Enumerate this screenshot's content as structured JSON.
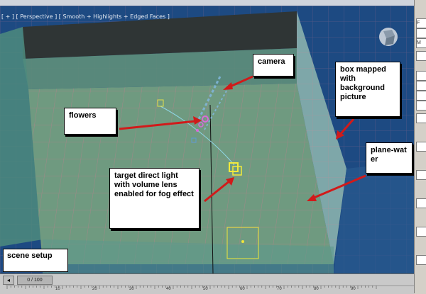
{
  "viewport": {
    "label": "[ + ] [ Perspective ] [ Smooth + Highlights + Edged Faces ]",
    "background": "#1a3f73",
    "grid_color": "#c87a8e",
    "floor_color": "#6f9a80"
  },
  "annotations": {
    "camera": "camera",
    "box": "box mapped with background picture",
    "flowers": "flowers",
    "plane_water": "plane-water",
    "light": "target direct light with volume lens enabled for fog effect",
    "scene": "scene setup"
  },
  "timeline": {
    "slider_label": "0 / 100",
    "ticks": [
      "10",
      "20",
      "30",
      "40",
      "50",
      "60",
      "70",
      "80",
      "90"
    ]
  },
  "right_panel": {
    "items": [
      "F",
      "",
      "M",
      "",
      "",
      "",
      "",
      "",
      "",
      "",
      "",
      "",
      "",
      ""
    ]
  },
  "arrow_color": "#d11a1a"
}
